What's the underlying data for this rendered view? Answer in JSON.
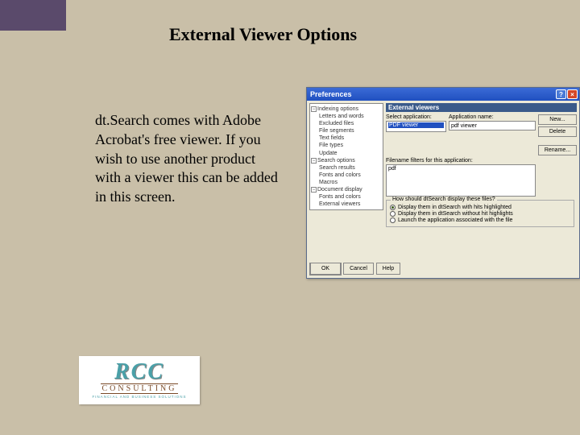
{
  "title": "External Viewer Options",
  "body_text": "dt.Search comes with Adobe Acrobat's free viewer.  If you wish to use another product with a viewer this can be added in this screen.",
  "dialog": {
    "title": "Preferences",
    "tree": {
      "n0": "Indexing options",
      "n0a": "Letters and words",
      "n0b": "Excluded files",
      "n0c": "File segments",
      "n0d": "Text fields",
      "n0e": "File types",
      "n0f": "Update",
      "n1": "Search options",
      "n1a": "Search results",
      "n1b": "Fonts and colors",
      "n1c": "Macros",
      "n2": "Document display",
      "n2a": "Fonts and colors",
      "n2b": "External viewers"
    },
    "panel_header": "External viewers",
    "select_app_label": "Select application:",
    "app_list_item": "PDF viewer",
    "app_name_label": "Application name:",
    "app_name_value": "pdf viewer",
    "filters_label": "Filename filters for this application:",
    "filters_value": "pdf",
    "buttons": {
      "new": "New...",
      "delete": "Delete",
      "rename": "Rename...",
      "ok": "OK",
      "cancel": "Cancel",
      "help": "Help"
    },
    "group": {
      "legend": "How should dtSearch display these files?",
      "r1": "Display them in dtSearch with hits highlighted",
      "r2": "Display them in dtSearch without hit highlights",
      "r3": "Launch the application associated with the file"
    }
  },
  "logo": {
    "main": "RCC",
    "sub": "CONSULTING",
    "tagline": "FINANCIAL AND BUSINESS SOLUTIONS"
  }
}
